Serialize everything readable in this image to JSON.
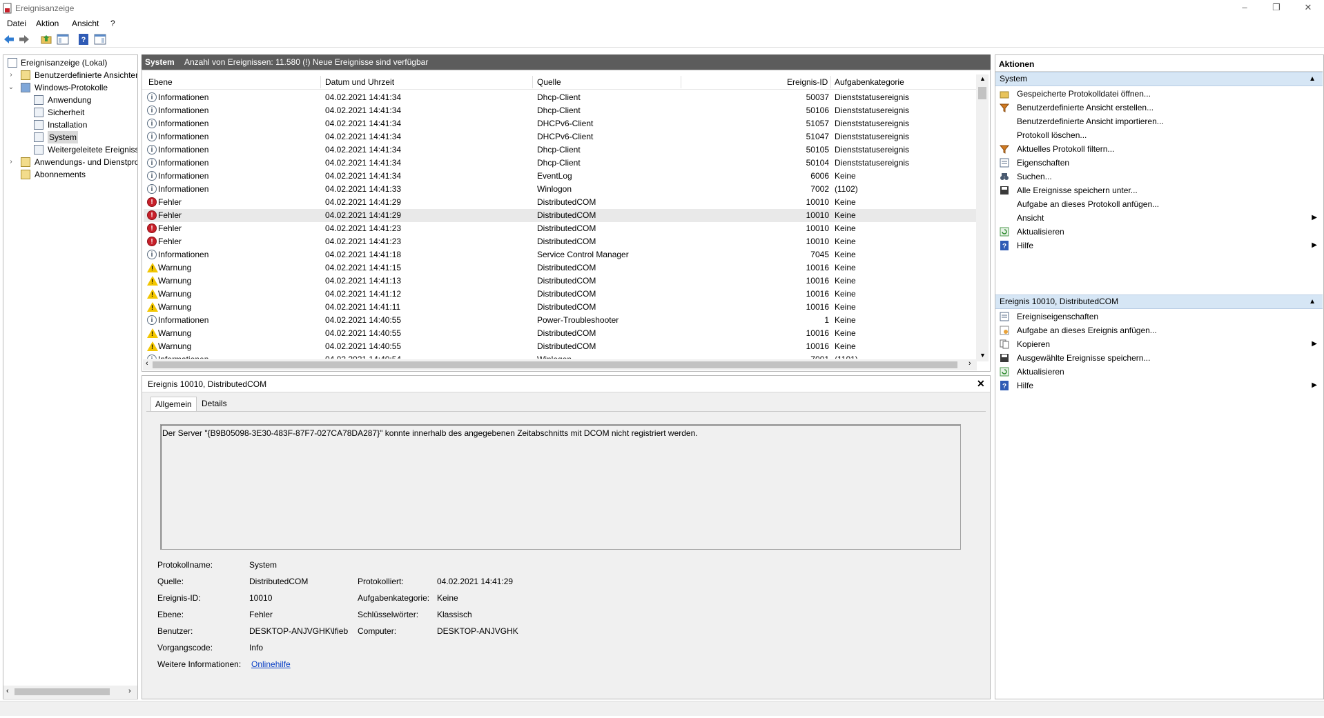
{
  "window": {
    "title": "Ereignisanzeige"
  },
  "menu": [
    "Datei",
    "Aktion",
    "Ansicht",
    "?"
  ],
  "tree": [
    {
      "label": "Ereignisanzeige (Lokal)"
    },
    {
      "label": "Benutzerdefinierte Ansichten"
    },
    {
      "label": "Windows-Protokolle"
    },
    {
      "label": "Anwendung"
    },
    {
      "label": "Sicherheit"
    },
    {
      "label": "Installation"
    },
    {
      "label": "System"
    },
    {
      "label": "Weitergeleitete Ereignisse"
    },
    {
      "label": "Anwendungs- und Dienstprotokolle"
    },
    {
      "label": "Abonnements"
    }
  ],
  "center": {
    "title": "System",
    "count_text": "Anzahl von Ereignissen: 11.580 (!) Neue Ereignisse sind verfügbar"
  },
  "columns": {
    "level": "Ebene",
    "date": "Datum und Uhrzeit",
    "source": "Quelle",
    "id": "Ereignis-ID",
    "category": "Aufgabenkategorie"
  },
  "events": [
    {
      "level": "Informationen",
      "type": "info",
      "date": "04.02.2021 14:41:34",
      "source": "Dhcp-Client",
      "id": "50037",
      "category": "Dienststatusereignis"
    },
    {
      "level": "Informationen",
      "type": "info",
      "date": "04.02.2021 14:41:34",
      "source": "Dhcp-Client",
      "id": "50106",
      "category": "Dienststatusereignis"
    },
    {
      "level": "Informationen",
      "type": "info",
      "date": "04.02.2021 14:41:34",
      "source": "DHCPv6-Client",
      "id": "51057",
      "category": "Dienststatusereignis"
    },
    {
      "level": "Informationen",
      "type": "info",
      "date": "04.02.2021 14:41:34",
      "source": "DHCPv6-Client",
      "id": "51047",
      "category": "Dienststatusereignis"
    },
    {
      "level": "Informationen",
      "type": "info",
      "date": "04.02.2021 14:41:34",
      "source": "Dhcp-Client",
      "id": "50105",
      "category": "Dienststatusereignis"
    },
    {
      "level": "Informationen",
      "type": "info",
      "date": "04.02.2021 14:41:34",
      "source": "Dhcp-Client",
      "id": "50104",
      "category": "Dienststatusereignis"
    },
    {
      "level": "Informationen",
      "type": "info",
      "date": "04.02.2021 14:41:34",
      "source": "EventLog",
      "id": "6006",
      "category": "Keine"
    },
    {
      "level": "Informationen",
      "type": "info",
      "date": "04.02.2021 14:41:33",
      "source": "Winlogon",
      "id": "7002",
      "category": "(1102)"
    },
    {
      "level": "Fehler",
      "type": "error",
      "date": "04.02.2021 14:41:29",
      "source": "DistributedCOM",
      "id": "10010",
      "category": "Keine"
    },
    {
      "level": "Fehler",
      "type": "error",
      "date": "04.02.2021 14:41:29",
      "source": "DistributedCOM",
      "id": "10010",
      "category": "Keine"
    },
    {
      "level": "Fehler",
      "type": "error",
      "date": "04.02.2021 14:41:23",
      "source": "DistributedCOM",
      "id": "10010",
      "category": "Keine"
    },
    {
      "level": "Fehler",
      "type": "error",
      "date": "04.02.2021 14:41:23",
      "source": "DistributedCOM",
      "id": "10010",
      "category": "Keine"
    },
    {
      "level": "Informationen",
      "type": "info",
      "date": "04.02.2021 14:41:18",
      "source": "Service Control Manager",
      "id": "7045",
      "category": "Keine"
    },
    {
      "level": "Warnung",
      "type": "warning",
      "date": "04.02.2021 14:41:15",
      "source": "DistributedCOM",
      "id": "10016",
      "category": "Keine"
    },
    {
      "level": "Warnung",
      "type": "warning",
      "date": "04.02.2021 14:41:13",
      "source": "DistributedCOM",
      "id": "10016",
      "category": "Keine"
    },
    {
      "level": "Warnung",
      "type": "warning",
      "date": "04.02.2021 14:41:12",
      "source": "DistributedCOM",
      "id": "10016",
      "category": "Keine"
    },
    {
      "level": "Warnung",
      "type": "warning",
      "date": "04.02.2021 14:41:11",
      "source": "DistributedCOM",
      "id": "10016",
      "category": "Keine"
    },
    {
      "level": "Informationen",
      "type": "info",
      "date": "04.02.2021 14:40:55",
      "source": "Power-Troubleshooter",
      "id": "1",
      "category": "Keine"
    },
    {
      "level": "Warnung",
      "type": "warning",
      "date": "04.02.2021 14:40:55",
      "source": "DistributedCOM",
      "id": "10016",
      "category": "Keine"
    },
    {
      "level": "Warnung",
      "type": "warning",
      "date": "04.02.2021 14:40:55",
      "source": "DistributedCOM",
      "id": "10016",
      "category": "Keine"
    },
    {
      "level": "Informationen",
      "type": "info",
      "date": "04.02.2021 14:40:54",
      "source": "Winlogon",
      "id": "7001",
      "category": "(1101)"
    }
  ],
  "detail": {
    "title": "Ereignis 10010, DistributedCOM",
    "tabs": [
      "Allgemein",
      "Details"
    ],
    "message": "Der Server \"{B9B05098-3E30-483F-87F7-027CA78DA287}\" konnte innerhalb des angegebenen Zeitabschnitts mit DCOM nicht registriert werden.",
    "labels": {
      "log": "Protokollname:",
      "source": "Quelle:",
      "id": "Ereignis-ID:",
      "level": "Ebene:",
      "user": "Benutzer:",
      "opcode": "Vorgangscode:",
      "more": "Weitere Informationen:",
      "logged": "Protokolliert:",
      "category": "Aufgabenkategorie:",
      "keywords": "Schlüsselwörter:",
      "computer": "Computer:"
    },
    "values": {
      "log": "System",
      "source": "DistributedCOM",
      "id": "10010",
      "level": "Fehler",
      "user": "DESKTOP-ANJVGHK\\lfieb",
      "opcode": "Info",
      "more": "Onlinehilfe",
      "logged": "04.02.2021 14:41:29",
      "category": "Keine",
      "keywords": "Klassisch",
      "computer": "DESKTOP-ANJVGHK"
    }
  },
  "actions": {
    "title": "Aktionen",
    "system_header": "System",
    "system_items": [
      {
        "label": "Gespeicherte Protokolldatei öffnen...",
        "icon": "folder-open-icon"
      },
      {
        "label": "Benutzerdefinierte Ansicht erstellen...",
        "icon": "filter-icon"
      },
      {
        "label": "Benutzerdefinierte Ansicht importieren...",
        "icon": ""
      },
      {
        "label": "Protokoll löschen...",
        "icon": ""
      },
      {
        "label": "Aktuelles Protokoll filtern...",
        "icon": "filter-icon"
      },
      {
        "label": "Eigenschaften",
        "icon": "properties-icon"
      },
      {
        "label": "Suchen...",
        "icon": "binoculars-icon"
      },
      {
        "label": "Alle Ereignisse speichern unter...",
        "icon": "save-icon"
      },
      {
        "label": "Aufgabe an dieses Protokoll anfügen...",
        "icon": ""
      },
      {
        "label": "Ansicht",
        "icon": "",
        "submenu": true
      },
      {
        "label": "Aktualisieren",
        "icon": "refresh-icon"
      },
      {
        "label": "Hilfe",
        "icon": "help-icon",
        "submenu": true
      }
    ],
    "event_header": "Ereignis 10010, DistributedCOM",
    "event_items": [
      {
        "label": "Ereigniseigenschaften",
        "icon": "properties-icon"
      },
      {
        "label": "Aufgabe an dieses Ereignis anfügen...",
        "icon": "task-icon"
      },
      {
        "label": "Kopieren",
        "icon": "copy-icon",
        "submenu": true
      },
      {
        "label": "Ausgewählte Ereignisse speichern...",
        "icon": "save-icon"
      },
      {
        "label": "Aktualisieren",
        "icon": "refresh-icon"
      },
      {
        "label": "Hilfe",
        "icon": "help-icon",
        "submenu": true
      }
    ]
  }
}
